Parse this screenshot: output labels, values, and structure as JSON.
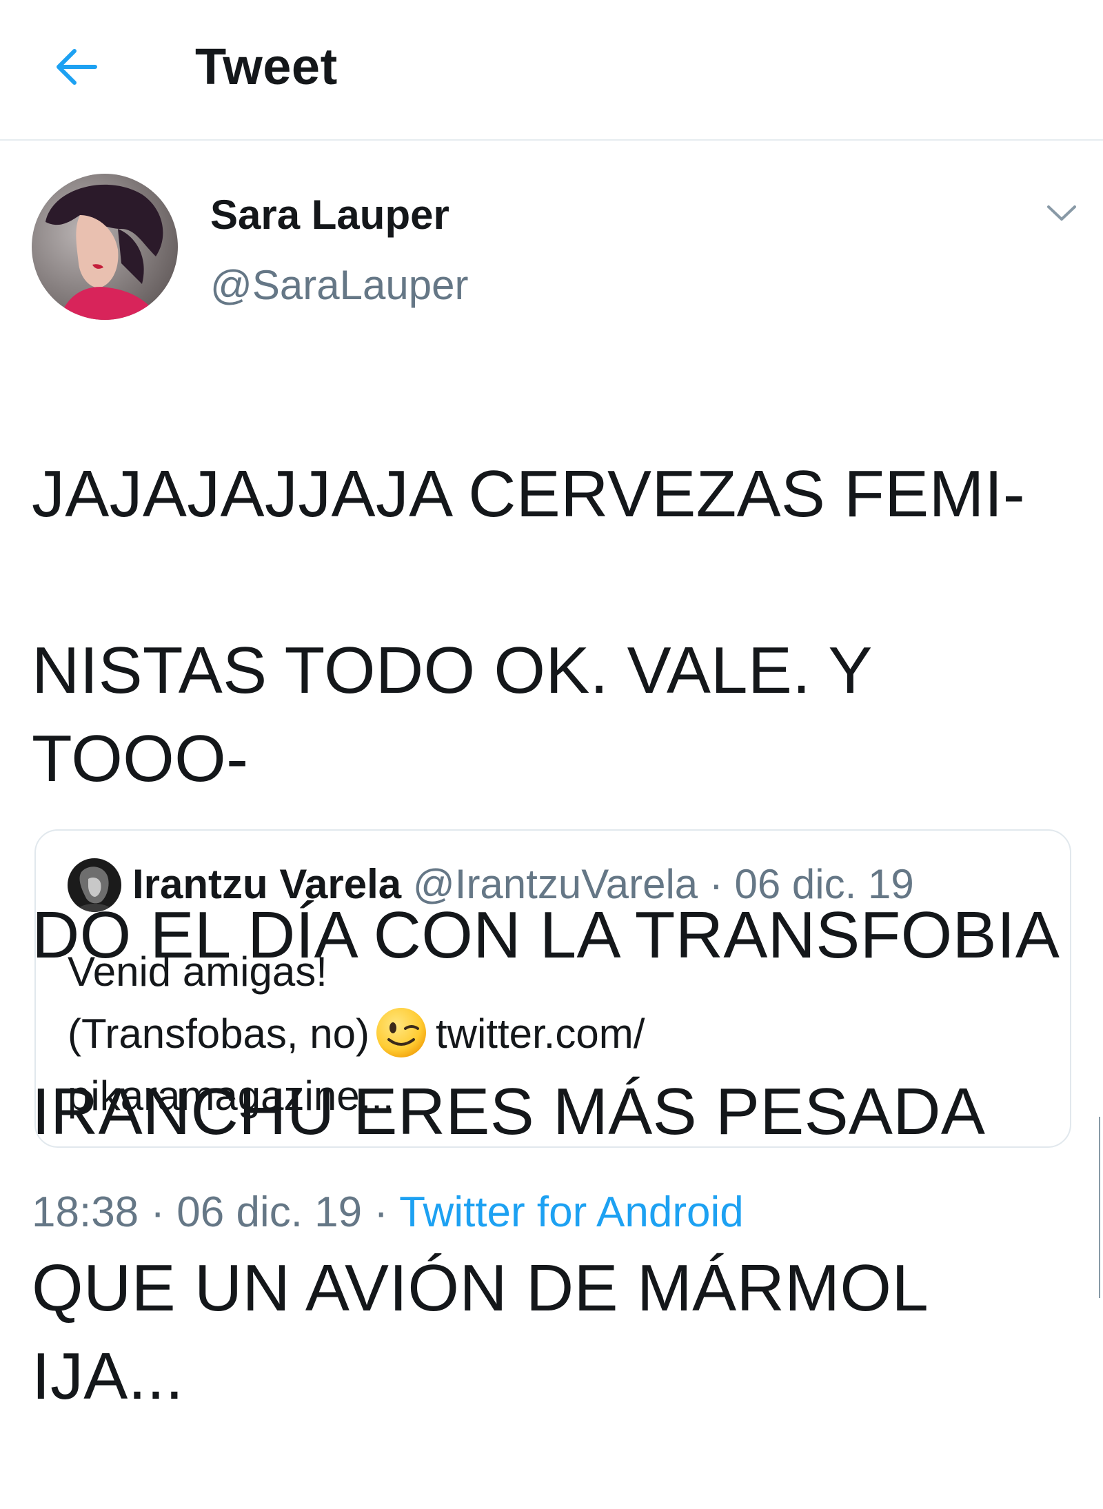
{
  "header": {
    "title": "Tweet",
    "back_icon": "arrow-left-icon",
    "accent_color": "#1da1f2"
  },
  "tweet": {
    "author_name": "Sara Lauper",
    "author_handle": "@SaraLauper",
    "menu_icon": "chevron-down-icon",
    "text_lines": [
      "JAJAJAJJAJA CERVEZAS FEMI-",
      "NISTAS TODO OK. VALE. Y TOOO-",
      "DO EL DÍA CON LA TRANSFOBIA",
      "IRANCHU ERES MÁS PESADA",
      "QUE UN AVIÓN DE MÁRMOL IJA..."
    ]
  },
  "quote": {
    "author_name": "Irantzu Varela",
    "meta": "@IrantzuVarela · 06 dic. 19",
    "line1": "Venid amigas!",
    "line2_text": "(Transfobas, no)",
    "line2_emoji": "winking-face-emoji",
    "line2_link": "twitter.com/",
    "line3": "pikaramagazine..."
  },
  "footer": {
    "meta": "18:38 · 06 dic. 19 · ",
    "source": "Twitter for Android"
  }
}
